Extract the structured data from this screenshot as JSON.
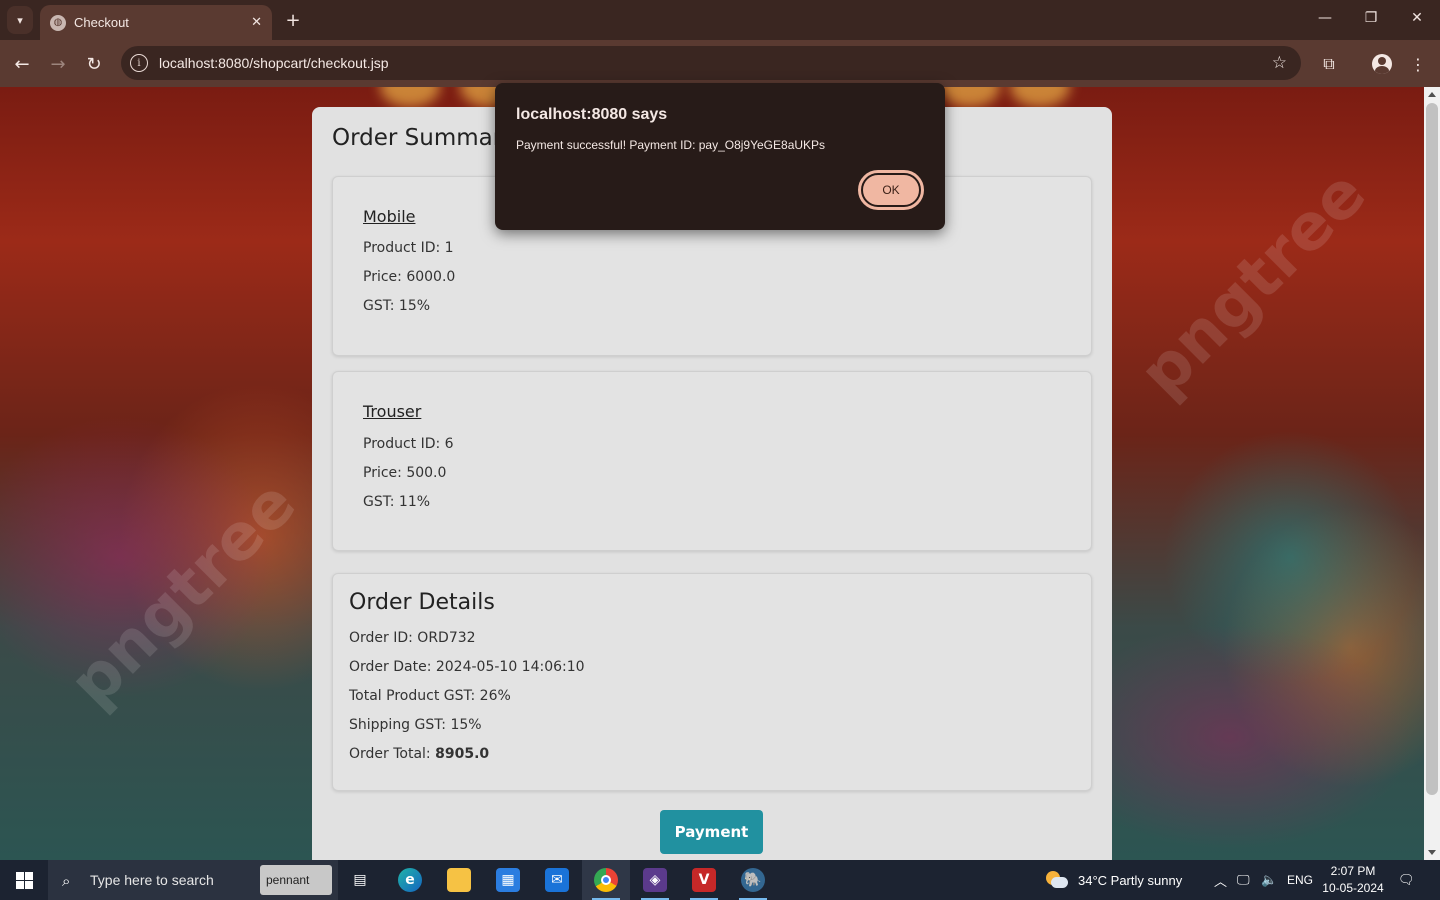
{
  "browser": {
    "tab_title": "Checkout",
    "url": "localhost:8080/shopcart/checkout.jsp"
  },
  "page": {
    "title": "Order Summary",
    "products": [
      {
        "name": "Mobile",
        "product_id": "Product ID: 1",
        "price": "Price: 6000.0",
        "gst": "GST: 15%"
      },
      {
        "name": "Trouser",
        "product_id": "Product ID: 6",
        "price": "Price: 500.0",
        "gst": "GST: 11%"
      }
    ],
    "order_details": {
      "title": "Order Details",
      "order_id": "Order ID: ORD732",
      "order_date": "Order Date: 2024-05-10 14:06:10",
      "total_product_gst": "Total Product GST: 26%",
      "shipping_gst": "Shipping GST: 15%",
      "order_total_label": "Order Total: ",
      "order_total_value": "8905.0"
    },
    "payment_button": "Payment",
    "watermark": "pngtree"
  },
  "dialog": {
    "title": "localhost:8080 says",
    "message": "Payment successful! Payment ID: pay_O8j9YeGE8aUKPs",
    "ok_label": "OK"
  },
  "taskbar": {
    "search_placeholder": "Type here to search",
    "search_promo": "pennant",
    "weather": "34°C  Partly sunny",
    "language": "ENG",
    "time": "2:07 PM",
    "date": "10-05-2024"
  },
  "colors": {
    "accent_button": "#2191a0",
    "dialog_bg": "#271b18",
    "ok_button": "#f0b7a2",
    "browser_toolbar": "#5a3a31"
  }
}
